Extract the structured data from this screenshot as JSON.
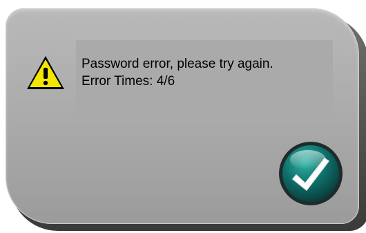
{
  "dialog": {
    "message_line1": "Password error, please try again.",
    "message_line2": "Error Times: 4/6"
  },
  "icons": {
    "warning": "warning-icon",
    "confirm": "checkmark-icon"
  },
  "colors": {
    "dialog_bg": "#b1b1b1",
    "warning_yellow": "#f3e600",
    "button_teal": "#0f6f6b",
    "button_ring": "#1e2b2a"
  }
}
